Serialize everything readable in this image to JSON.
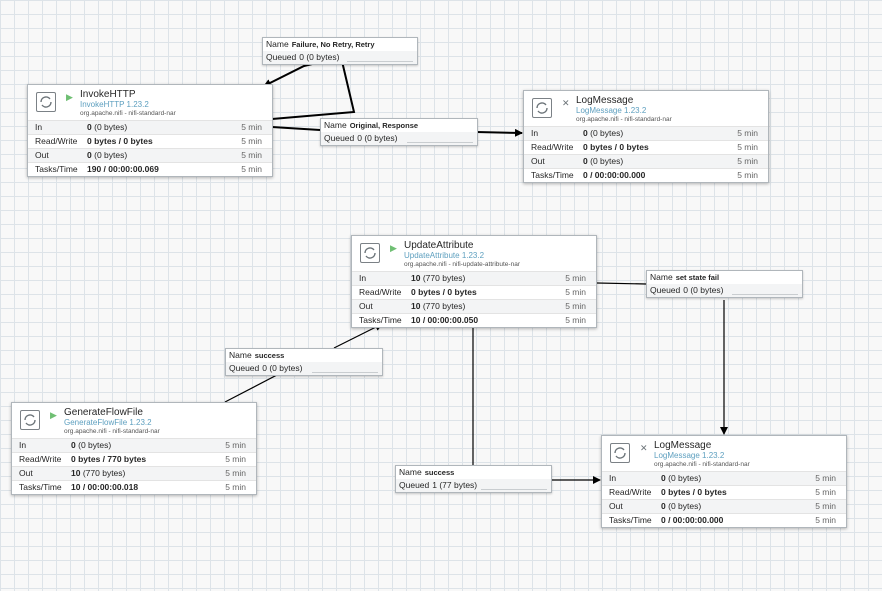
{
  "processors": {
    "invokehttp": {
      "name": "InvokeHTTP",
      "type": "InvokeHTTP 1.23.2",
      "bundle": "org.apache.nifi - nifi-standard-nar",
      "state_icon": "play-icon",
      "in": "0",
      "in_size": "(0 bytes)",
      "rw": "0 bytes / 0 bytes",
      "out": "0",
      "out_size": "(0 bytes)",
      "tasks": "190 / 00:00:00.069"
    },
    "logmessage_top": {
      "name": "LogMessage",
      "type": "LogMessage 1.23.2",
      "bundle": "org.apache.nifi - nifi-standard-nar",
      "state_icon": "invalid-run-icon",
      "in": "0",
      "in_size": "(0 bytes)",
      "rw": "0 bytes / 0 bytes",
      "out": "0",
      "out_size": "(0 bytes)",
      "tasks": "0 / 00:00:00.000"
    },
    "updateattribute": {
      "name": "UpdateAttribute",
      "type": "UpdateAttribute 1.23.2",
      "bundle": "org.apache.nifi - nifi-update-attribute-nar",
      "state_icon": "play-icon",
      "in": "10",
      "in_size": "(770 bytes)",
      "rw": "0 bytes / 0 bytes",
      "out": "10",
      "out_size": "(770 bytes)",
      "tasks": "10 / 00:00:00.050"
    },
    "generateflowfile": {
      "name": "GenerateFlowFile",
      "type": "GenerateFlowFile 1.23.2",
      "bundle": "org.apache.nifi - nifi-standard-nar",
      "state_icon": "play-icon",
      "in": "0",
      "in_size": "(0 bytes)",
      "rw": "0 bytes / 770 bytes",
      "out": "10",
      "out_size": "(770 bytes)",
      "tasks": "10 / 00:00:00.018"
    },
    "logmessage_bottom": {
      "name": "LogMessage",
      "type": "LogMessage 1.23.2",
      "bundle": "org.apache.nifi - nifi-standard-nar",
      "state_icon": "invalid-run-icon",
      "in": "0",
      "in_size": "(0 bytes)",
      "rw": "0 bytes / 0 bytes",
      "out": "0",
      "out_size": "(0 bytes)",
      "tasks": "0 / 00:00:00.000"
    }
  },
  "labels": {
    "in": "In",
    "rw": "Read/Write",
    "out": "Out",
    "tasks": "Tasks/Time",
    "window": "5 min",
    "name": "Name",
    "queued": "Queued"
  },
  "connections": {
    "failure": {
      "name": "Failure, No Retry, Retry",
      "queued": "0 (0 bytes)"
    },
    "original": {
      "name": "Original, Response",
      "queued": "0 (0 bytes)"
    },
    "success_gen": {
      "name": "success",
      "queued": "0 (0 bytes)"
    },
    "state_fail": {
      "name": "set state fail",
      "queued": "0 (0 bytes)"
    },
    "success_upd": {
      "name": "success",
      "queued": "1 (77 bytes)"
    }
  },
  "colors": {
    "running": "#6fbf73",
    "edge": "#000000",
    "type_text": "#5d9fbf"
  }
}
